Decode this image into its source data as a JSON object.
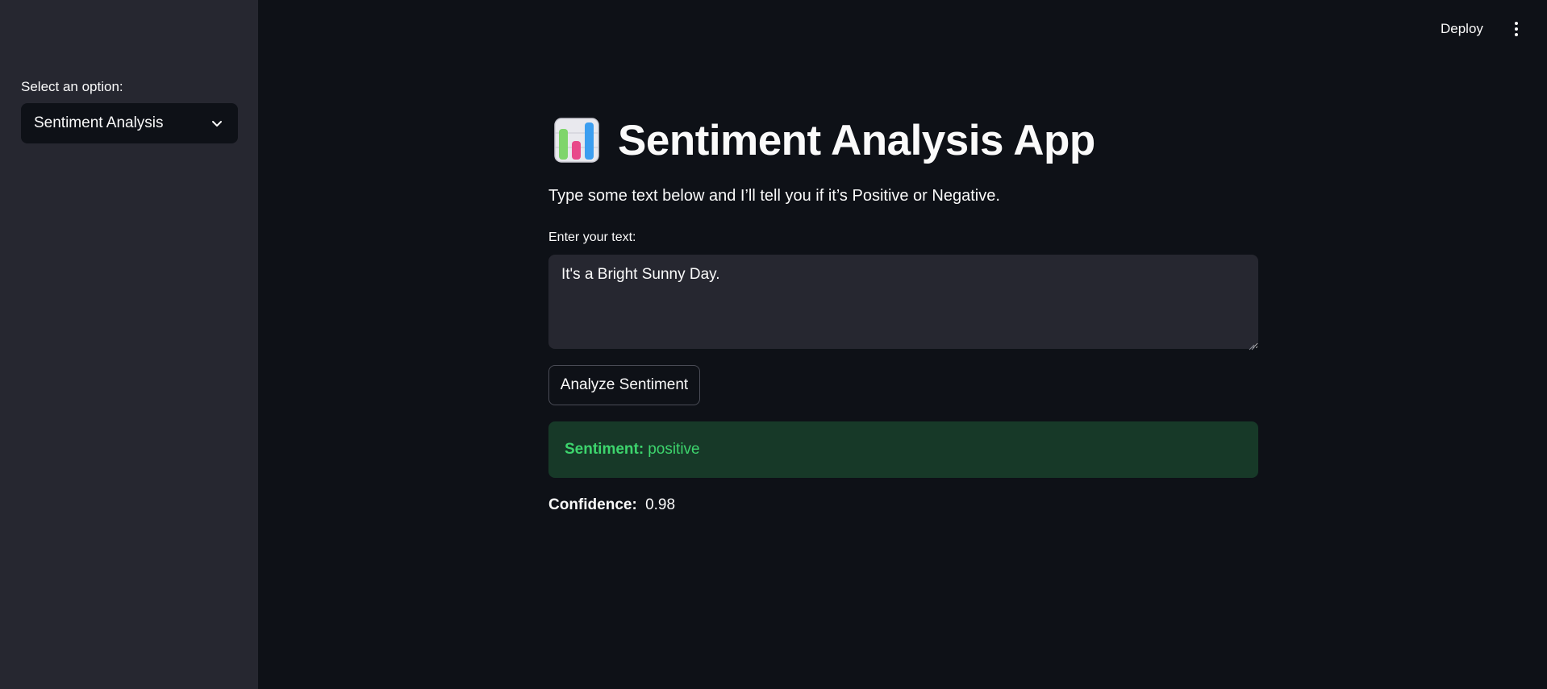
{
  "sidebar": {
    "select_label": "Select an option:",
    "selected_option": "Sentiment Analysis"
  },
  "header": {
    "deploy_label": "Deploy",
    "menu_icon": "vertical-dots-icon"
  },
  "main": {
    "title_icon": "bar-chart-emoji-icon",
    "title": "Sentiment Analysis App",
    "subtitle": "Type some text below and I’ll tell you if it’s Positive or Negative.",
    "input_label": "Enter your text:",
    "input_value": "It's a Bright Sunny Day.",
    "analyze_button_label": "Analyze Sentiment",
    "result": {
      "label": "Sentiment:",
      "value": "positive"
    },
    "confidence": {
      "label": "Confidence:",
      "value": "0.98"
    }
  },
  "colors": {
    "background": "#0e1117",
    "sidebar": "#262730",
    "success_bg": "#173928",
    "success_text": "#3dd56d"
  }
}
